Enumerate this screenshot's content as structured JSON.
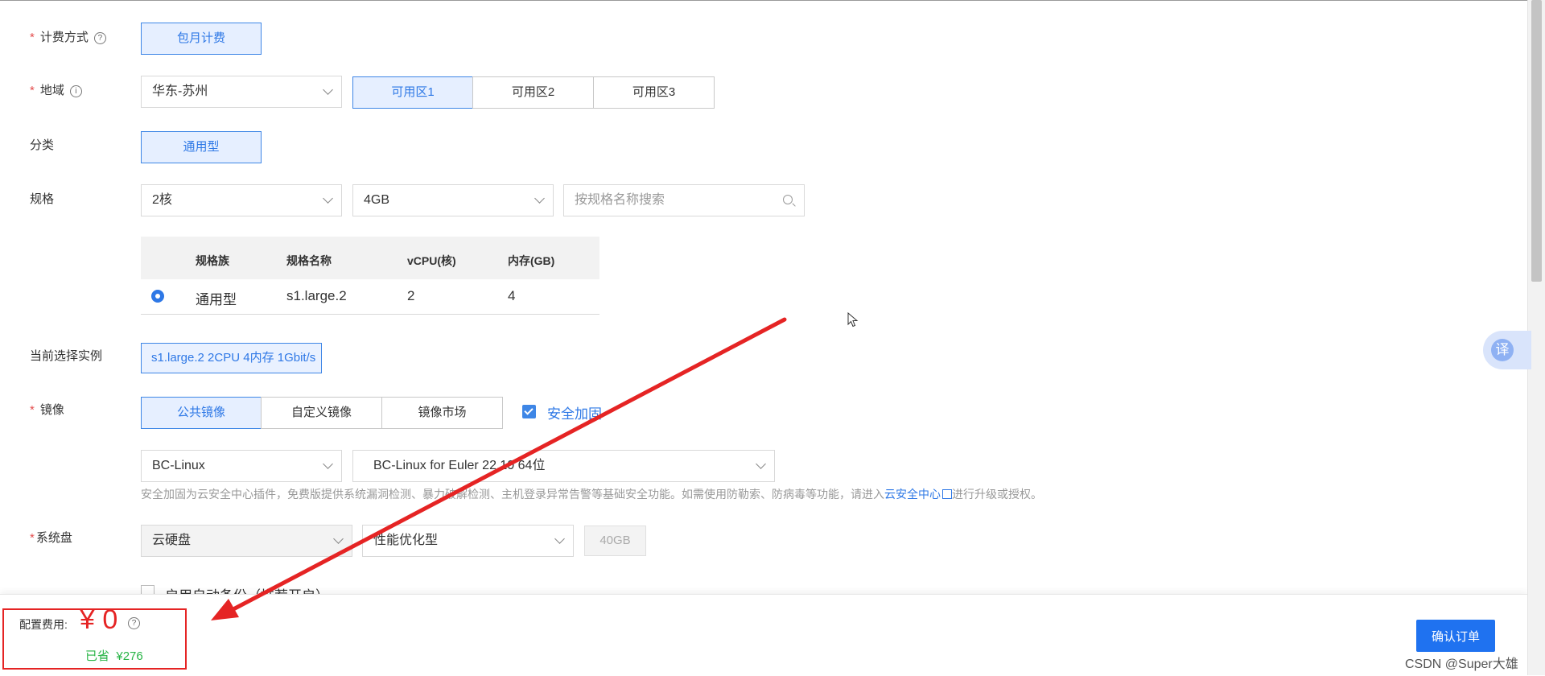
{
  "form": {
    "billing": {
      "label": "计费方式",
      "options": [
        "包月计费"
      ]
    },
    "region": {
      "label": "地域",
      "value": "华东-苏州",
      "zones": [
        "可用区1",
        "可用区2",
        "可用区3"
      ]
    },
    "category": {
      "label": "分类",
      "options": [
        "通用型"
      ]
    },
    "spec": {
      "label": "规格",
      "cpu": "2核",
      "mem": "4GB",
      "search_placeholder": "按规格名称搜索",
      "table": {
        "headers": [
          "规格族",
          "规格名称",
          "vCPU(核)",
          "内存(GB)"
        ],
        "rows": [
          [
            "通用型",
            "s1.large.2",
            "2",
            "4"
          ]
        ]
      }
    },
    "current": {
      "label": "当前选择实例",
      "value": "s1.large.2 2CPU 4内存 1Gbit/s"
    },
    "image": {
      "label": "镜像",
      "tabs": [
        "公共镜像",
        "自定义镜像",
        "镜像市场"
      ],
      "security_label": "安全加固",
      "os": "BC-Linux",
      "version": "BC-Linux for Euler 22.10 64位",
      "hint_before": "安全加固为云安全中心插件，免费版提供系统漏洞检测、暴力破解检测、主机登录异常告警等基础安全功能。如需使用防勒索、防病毒等功能，请进入",
      "hint_link": "云安全中心",
      "hint_after": "进行升级或授权。"
    },
    "disk": {
      "label": "系统盘",
      "type": "云硬盘",
      "perf": "性能优化型",
      "size": "40GB"
    },
    "backup": {
      "label": "启用自动备份（推荐开启）"
    }
  },
  "footer": {
    "cost_label": "配置费用:",
    "cost_value": "¥ 0",
    "saved_label": "已省",
    "saved_value": "¥276",
    "confirm_label": "确认订单"
  },
  "float": {
    "translate": "译"
  },
  "watermark": "CSDN @Super大雄",
  "colors": {
    "accent": "#2e78e6",
    "required": "#e34d4d",
    "annotation": "#e52424",
    "saved": "#28b446"
  },
  "icons": [
    "help-icon",
    "info-icon",
    "chevron-down-icon",
    "search-icon",
    "check-icon",
    "external-link-icon",
    "mouse-cursor-icon",
    "annotation-arrow"
  ]
}
